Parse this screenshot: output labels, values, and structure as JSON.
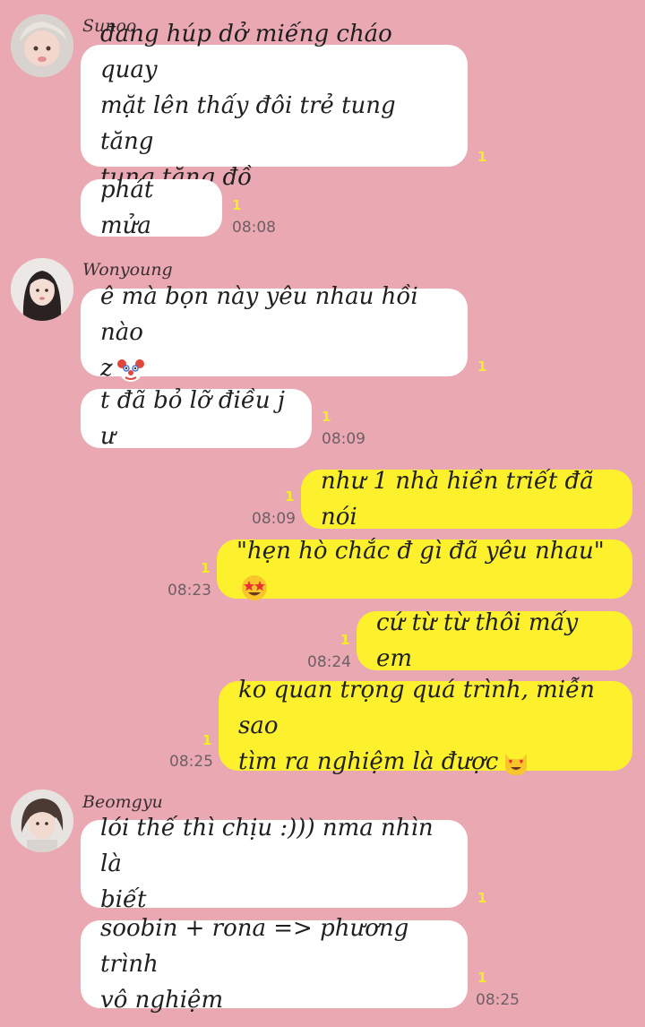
{
  "chat": {
    "groups": [
      {
        "sender": "Sunoo",
        "messages": [
          {
            "text": "đang húp dở miếng cháo quay\nmặt lên thấy đôi trẻ tung tăng\ntung tăng đồ",
            "read": "1"
          },
          {
            "text": "phát mửa",
            "read": "1",
            "time": "08:08"
          }
        ]
      },
      {
        "sender": "Wonyoung",
        "messages": [
          {
            "text": "ê mà bọn này yêu nhau hồi nào\nz",
            "emoji": "clown-face",
            "read": "1"
          },
          {
            "text": "t đã bỏ lỡ điều j ư",
            "read": "1",
            "time": "08:09"
          }
        ]
      },
      {
        "sender": "me",
        "messages": [
          {
            "text": "như 1 nhà hiền triết đã nói",
            "read": "1",
            "time": "08:09"
          },
          {
            "text": "\"hẹn hò chắc đ gì đã yêu nhau\"",
            "emoji": "star-struck",
            "read": "1",
            "time": "08:23"
          },
          {
            "text": "cứ từ từ thôi mấy em",
            "read": "1",
            "time": "08:24"
          },
          {
            "text": "ko quan trọng quá trình, miễn sao\ntìm ra nghiệm là được",
            "emoji": "heart-eyes-cat",
            "read": "1",
            "time": "08:25"
          }
        ]
      },
      {
        "sender": "Beomgyu",
        "messages": [
          {
            "text": "lói thế thì chịu :))) nma nhìn là\nbiết",
            "read": "1"
          },
          {
            "text": "soobin + rona => phương trình\nvô nghiệm",
            "read": "1",
            "time": "08:25"
          }
        ]
      }
    ]
  },
  "colors": {
    "background": "#eaa8b2",
    "incoming_bubble": "#ffffff",
    "outgoing_bubble": "#fdf02c",
    "read_receipt": "#f2ec2a"
  }
}
